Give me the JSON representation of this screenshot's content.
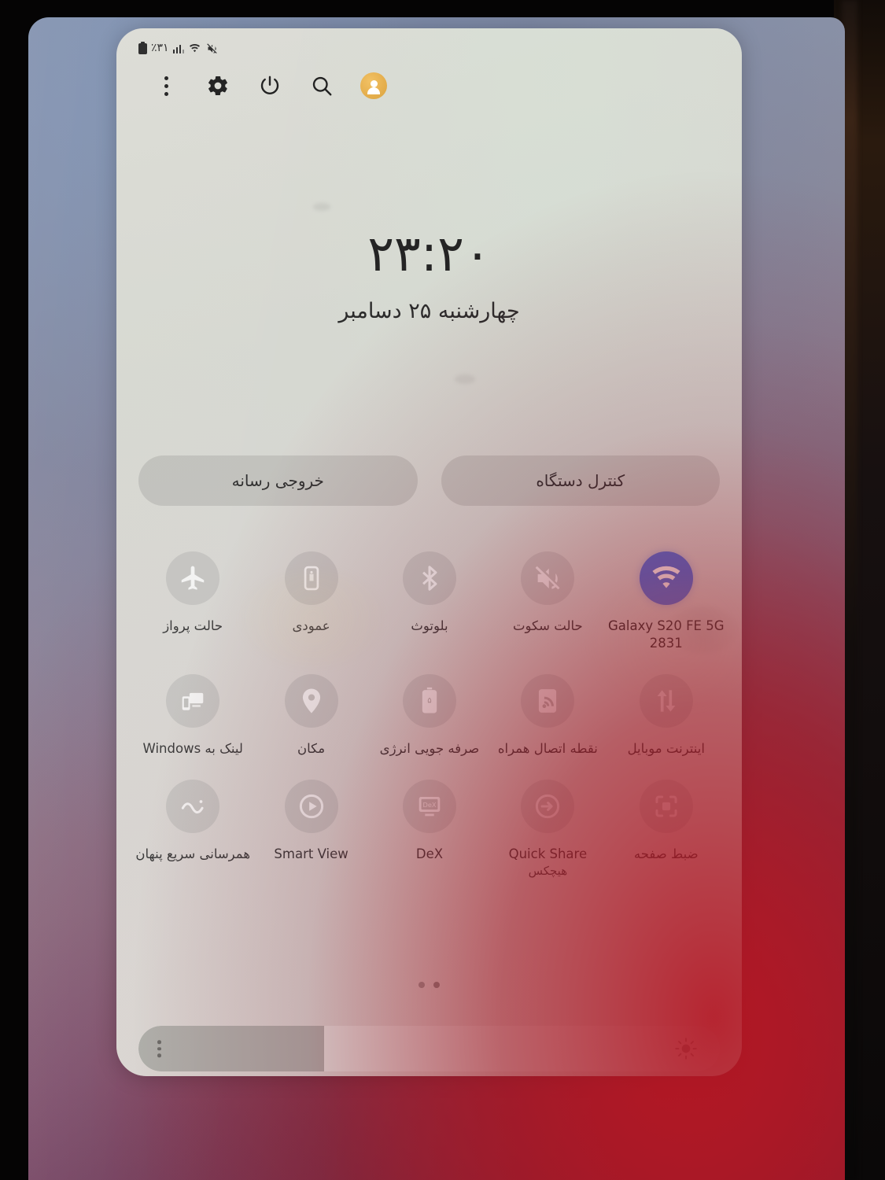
{
  "device": {
    "ui": "Samsung One UI Quick Settings panel (Persian)",
    "accent_blue": "#4a73e0",
    "avatar_color": "#e6b04e",
    "panel_bg": "#d7d8d2"
  },
  "status_bar": {
    "battery_percent": "٪٣١",
    "icons": [
      "battery-icon",
      "signal-bars-icon",
      "wifi-icon",
      "mute-icon"
    ]
  },
  "toolbar": {
    "buttons": [
      {
        "name": "more-options-button",
        "icon": "kebab-menu-icon"
      },
      {
        "name": "settings-button",
        "icon": "gear-icon"
      },
      {
        "name": "power-button",
        "icon": "power-icon"
      },
      {
        "name": "search-button",
        "icon": "search-icon"
      },
      {
        "name": "user-profile-button",
        "icon": "avatar-icon"
      }
    ]
  },
  "clock": {
    "time": "٢٣:٢٠",
    "date": "چهارشنبه ۲۵ دسامبر"
  },
  "pills": [
    {
      "label": "خروجی رسانه",
      "name": "media-output-button"
    },
    {
      "label": "کنترل دستگاه",
      "name": "device-control-button"
    }
  ],
  "tiles": [
    [
      {
        "label": "حالت پرواز",
        "icon": "airplane-icon",
        "active": false,
        "name": "tile-airplane-mode"
      },
      {
        "label": "عمودی",
        "icon": "rotation-portrait-icon",
        "active": false,
        "name": "tile-auto-rotate"
      },
      {
        "label": "بلوتوث",
        "icon": "bluetooth-icon",
        "active": false,
        "name": "tile-bluetooth"
      },
      {
        "label": "حالت سکوت",
        "icon": "mute-icon",
        "active": false,
        "name": "tile-mute"
      },
      {
        "label": "Galaxy S20 FE 5G 2831",
        "icon": "wifi-icon",
        "active": true,
        "name": "tile-wifi"
      }
    ],
    [
      {
        "label": "لینک به Windows",
        "icon": "link-to-windows-icon",
        "active": false,
        "name": "tile-link-to-windows"
      },
      {
        "label": "مکان",
        "icon": "location-pin-icon",
        "active": false,
        "name": "tile-location"
      },
      {
        "label": "صرفه جویی انرژی",
        "icon": "power-saving-icon",
        "active": false,
        "name": "tile-power-saving"
      },
      {
        "label": "نقطه اتصال همراه",
        "icon": "hotspot-icon",
        "active": false,
        "name": "tile-mobile-hotspot"
      },
      {
        "label": "اینترنت موبایل",
        "icon": "mobile-data-icon",
        "active": false,
        "name": "tile-mobile-data"
      }
    ],
    [
      {
        "label": "همرسانی سریع پنهان",
        "icon": "quick-share-wave-icon",
        "active": false,
        "name": "tile-quick-sharing"
      },
      {
        "label": "Smart View",
        "icon": "smart-view-icon",
        "active": false,
        "name": "tile-smart-view"
      },
      {
        "label": "DeX",
        "icon": "dex-icon",
        "active": false,
        "name": "tile-dex"
      },
      {
        "label": "Quick Share",
        "sub": "هیچکس",
        "icon": "quick-share-icon",
        "active": false,
        "name": "tile-quick-share"
      },
      {
        "label": "ضبط صفحه",
        "icon": "screen-recorder-icon",
        "active": false,
        "name": "tile-screen-recorder"
      }
    ]
  ],
  "page_dots": {
    "count": 2,
    "active_index": 1
  },
  "brightness": {
    "value_percent": 32,
    "menu_icon": "kebab-menu-icon",
    "level_icon": "brightness-sun-icon"
  }
}
